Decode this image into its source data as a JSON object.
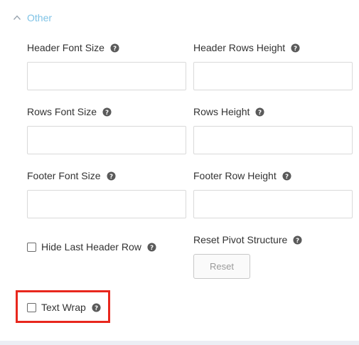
{
  "section": {
    "title": "Other",
    "icon": "chevron-up-icon"
  },
  "fields": {
    "header_font_size": {
      "label": "Header Font Size",
      "value": "",
      "placeholder": ""
    },
    "header_rows_height": {
      "label": "Header Rows Height",
      "value": "",
      "placeholder": ""
    },
    "rows_font_size": {
      "label": "Rows Font Size",
      "value": "",
      "placeholder": ""
    },
    "rows_height": {
      "label": "Rows Height",
      "value": "",
      "placeholder": ""
    },
    "footer_font_size": {
      "label": "Footer Font Size",
      "value": "",
      "placeholder": ""
    },
    "footer_row_height": {
      "label": "Footer Row Height",
      "value": "",
      "placeholder": ""
    }
  },
  "checkboxes": {
    "hide_last_header_row": {
      "label": "Hide Last Header Row",
      "checked": false
    },
    "text_wrap": {
      "label": "Text Wrap",
      "checked": false
    }
  },
  "reset_pivot": {
    "label": "Reset Pivot Structure",
    "button": "Reset"
  },
  "colors": {
    "section_title": "#7fc3e6",
    "highlight": "#e8271d",
    "help_icon": "#5a5a5a"
  },
  "help_icon": "question-circle-icon"
}
